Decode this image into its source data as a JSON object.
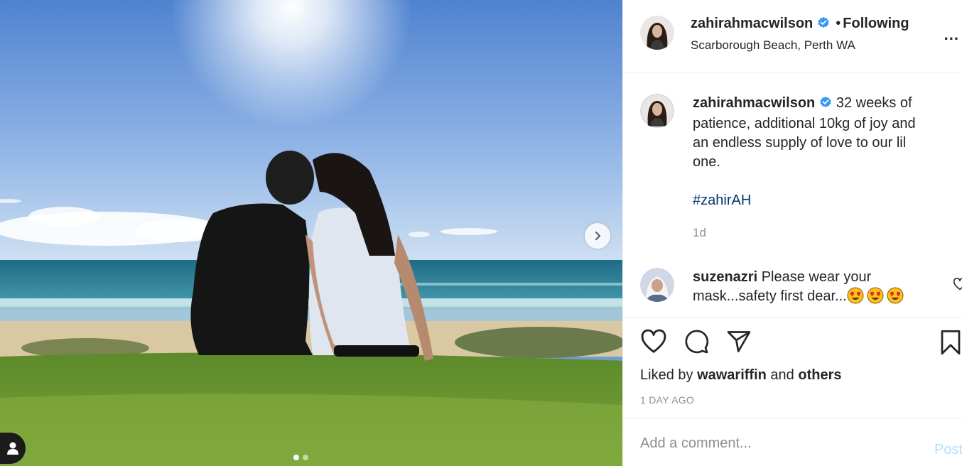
{
  "post": {
    "username": "zahirahmacwilson",
    "follow_separator": "•",
    "follow_status": "Following",
    "location": "Scarborough Beach, Perth WA",
    "more_label": "..."
  },
  "caption": {
    "username": "zahirahmacwilson",
    "text": "32 weeks of patience, additional 10kg of joy and an endless supply of love to our lil one.",
    "hashtag": "#zahirAH",
    "time": "1d"
  },
  "comment": {
    "username": "suzenazri",
    "text": "Please wear your mask...safety first dear...",
    "emojis": [
      "heart-eyes-emoji",
      "heart-eyes-emoji",
      "heart-eyes-emoji"
    ]
  },
  "likes": {
    "prefix": "Liked by",
    "user": "wawariffin",
    "joiner": "and",
    "others": "others"
  },
  "timestamp": "1 DAY AGO",
  "add_comment": {
    "placeholder": "Add a comment...",
    "post_label": "Post"
  },
  "carousel": {
    "current": 1,
    "total": 2
  },
  "icons": {
    "verified": "verified-badge-icon",
    "next": "chevron-right-icon",
    "tag": "user-tag-icon",
    "like": "heart-icon",
    "comment": "comment-bubble-icon",
    "share": "paper-plane-icon",
    "save": "bookmark-icon",
    "more": "ellipsis-icon"
  },
  "colors": {
    "verified": "#3897f0",
    "link": "#00376b",
    "muted": "#8e8e8e",
    "post_disabled": "#b2dffc"
  }
}
